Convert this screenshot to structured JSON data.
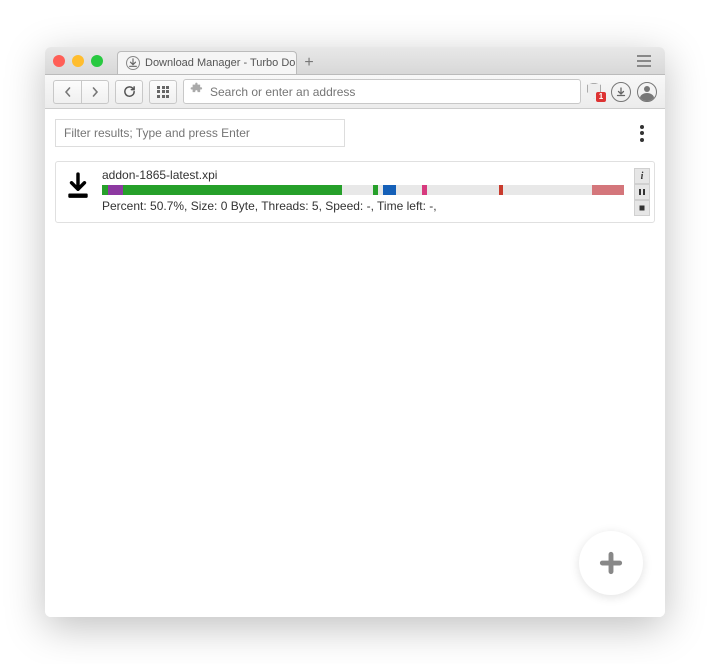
{
  "tab": {
    "title": "Download Manager - Turbo Do"
  },
  "urlbar": {
    "placeholder": "Search or enter an address",
    "shield_badge": "1"
  },
  "filter": {
    "placeholder": "Filter results; Type and press Enter"
  },
  "downloads": [
    {
      "name": "addon-1865-latest.xpi",
      "status": "Percent: 50.7%, Size: 0 Byte, Threads: 5, Speed: -, Time left: -,",
      "segments": [
        {
          "width": 1.2,
          "color": "#26a02a"
        },
        {
          "width": 2.8,
          "color": "#8d39a1"
        },
        {
          "width": 42.0,
          "color": "#26a02a"
        },
        {
          "width": 6.0,
          "color": "#e8e8e8"
        },
        {
          "width": 0.8,
          "color": "#26a02a"
        },
        {
          "width": 1.0,
          "color": "#e8e8e8"
        },
        {
          "width": 2.5,
          "color": "#1560b8"
        },
        {
          "width": 5.0,
          "color": "#e8e8e8"
        },
        {
          "width": 1.0,
          "color": "#d73a7e"
        },
        {
          "width": 13.7,
          "color": "#e8e8e8"
        },
        {
          "width": 0.8,
          "color": "#c93b2d"
        },
        {
          "width": 17.0,
          "color": "#e8e8e8"
        },
        {
          "width": 6.2,
          "color": "#d4767b"
        }
      ]
    }
  ]
}
